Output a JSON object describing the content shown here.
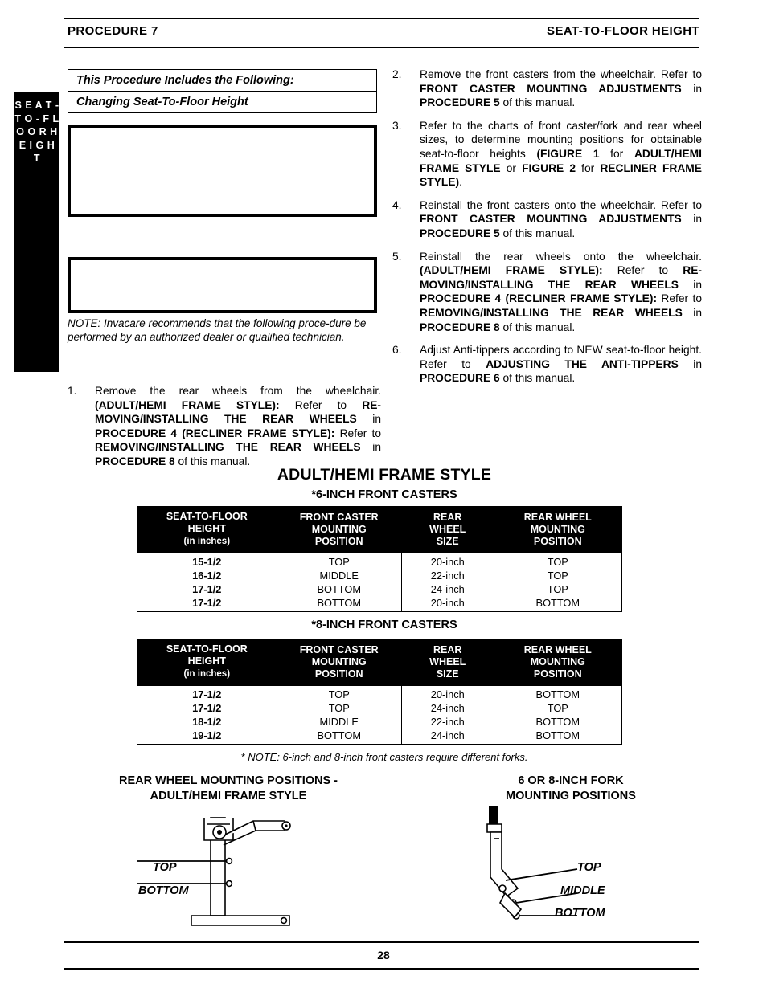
{
  "header": {
    "left": "PROCEDURE 7",
    "right": "SEAT-TO-FLOOR HEIGHT"
  },
  "side_tab": "S E A T - T O - F L O O R    H E I G H T",
  "procedure_box": {
    "title": "This Procedure Includes the Following:",
    "item": "Changing Seat-To-Floor Height"
  },
  "note_left": "NOTE: Invacare recommends that the following proce-dure be performed by an authorized dealer or qualified technician.",
  "steps_left": [
    {
      "num": "1.",
      "html": "Remove the rear wheels from the wheelchair. <b>(ADULT/HEMI FRAME STYLE):</b> Refer to <b>RE-MOVING/INSTALLING THE REAR WHEELS</b> in <b>PROCEDURE 4 (RECLINER FRAME STYLE):</b> Refer to <b>REMOVING/INSTALLING THE REAR WHEELS</b> in <b>PROCEDURE 8</b> of this manual."
    }
  ],
  "steps_right": [
    {
      "num": "2.",
      "html": "Remove the front casters from the wheelchair. Refer to <b>FRONT CASTER MOUNTING ADJUSTMENTS</b> in <b>PROCEDURE 5</b> of this manual."
    },
    {
      "num": "3.",
      "html": "Refer to the charts of front caster/fork and rear wheel sizes, to determine mounting positions for obtainable seat-to-floor heights <b>(FIGURE 1</b> for <b>ADULT/HEMI FRAME STYLE</b> or <b>FIGURE 2</b> for <b>RECLINER FRAME STYLE)</b>."
    },
    {
      "num": "4.",
      "html": "Reinstall the front casters onto the wheelchair. Refer to <b>FRONT CASTER MOUNTING ADJUSTMENTS</b> in <b>PROCEDURE 5</b> of this manual."
    },
    {
      "num": "5.",
      "html": "Reinstall the rear wheels onto the wheelchair. <b>(ADULT/HEMI FRAME STYLE):</b> Refer to <b>RE-MOVING/INSTALLING THE REAR WHEELS</b> in <b>PROCEDURE 4 (RECLINER FRAME STYLE):</b> Refer to <b>REMOVING/INSTALLING THE REAR WHEELS</b> in <b>PROCEDURE 8</b> of this manual."
    },
    {
      "num": "6.",
      "html": "Adjust Anti-tippers according to NEW seat-to-floor height. Refer to <b>ADJUSTING THE ANTI-TIPPERS</b> in <b>PROCEDURE 6</b> of this manual."
    }
  ],
  "figure": {
    "title": "ADULT/HEMI FRAME STYLE",
    "sub1": "*6-INCH FRONT CASTERS",
    "sub2": "*8-INCH FRONT CASTERS",
    "table_note": "* NOTE: 6-inch and 8-inch front casters require different forks."
  },
  "table_headers": [
    {
      "l1": "SEAT-TO-FLOOR",
      "l2": "HEIGHT",
      "l3": "(in inches)"
    },
    {
      "l1": "FRONT CASTER",
      "l2": "MOUNTING",
      "l3": "POSITION"
    },
    {
      "l1": "REAR",
      "l2": "WHEEL",
      "l3": "SIZE"
    },
    {
      "l1": "REAR WHEEL",
      "l2": "MOUNTING",
      "l3": "POSITION"
    }
  ],
  "table_6inch": [
    [
      "15-1/2",
      "TOP",
      "20-inch",
      "TOP"
    ],
    [
      "16-1/2",
      "MIDDLE",
      "22-inch",
      "TOP"
    ],
    [
      "17-1/2",
      "BOTTOM",
      "24-inch",
      "TOP"
    ],
    [
      "17-1/2",
      "BOTTOM",
      "20-inch",
      "BOTTOM"
    ]
  ],
  "table_8inch": [
    [
      "17-1/2",
      "TOP",
      "20-inch",
      "BOTTOM"
    ],
    [
      "17-1/2",
      "TOP",
      "24-inch",
      "TOP"
    ],
    [
      "18-1/2",
      "MIDDLE",
      "22-inch",
      "BOTTOM"
    ],
    [
      "19-1/2",
      "BOTTOM",
      "24-inch",
      "BOTTOM"
    ]
  ],
  "diagrams": {
    "left_caption_l1": "REAR WHEEL MOUNTING POSITIONS -",
    "left_caption_l2": "ADULT/HEMI FRAME STYLE",
    "right_caption_l1": "6 OR 8-INCH FORK",
    "right_caption_l2": "MOUNTING POSITIONS",
    "left_label_top": "TOP",
    "left_label_bottom": "BOTTOM",
    "right_label_top": "TOP",
    "right_label_middle": "MIDDLE",
    "right_label_bottom": "BOTTOM"
  },
  "footer": {
    "page_number": "28"
  }
}
